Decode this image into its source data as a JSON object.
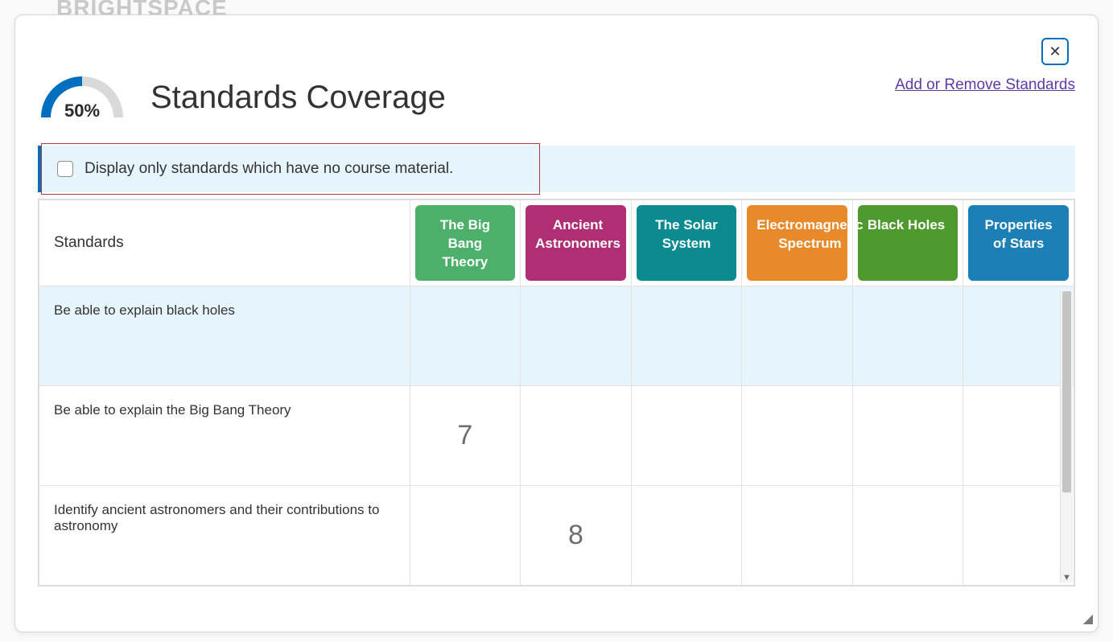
{
  "background_text": "BRIGHTSPACE",
  "header": {
    "coverage_percent": "50%",
    "title": "Standards Coverage",
    "action_link": "Add or Remove Standards"
  },
  "filter": {
    "label": "Display only standards which have no course material."
  },
  "table": {
    "standards_header": "Standards",
    "topics": [
      {
        "label": "The Big Bang Theory",
        "color": "#4caf6a"
      },
      {
        "label": "Ancient Astronomers",
        "color": "#b02f74"
      },
      {
        "label": "The Solar System",
        "color": "#0b8a8f"
      },
      {
        "label": "Electromagnetic Spectrum",
        "color": "#e88a2a"
      },
      {
        "label": "Black Holes",
        "color": "#4f9a2f"
      },
      {
        "label": "Properties of Stars",
        "color": "#1c7fb5"
      }
    ],
    "rows": [
      {
        "standard": "Be able to explain black holes",
        "values": [
          "",
          "",
          "",
          "",
          "",
          ""
        ],
        "highlight": true
      },
      {
        "standard": "Be able to explain the Big Bang Theory",
        "values": [
          "7",
          "",
          "",
          "",
          "",
          ""
        ],
        "highlight": false
      },
      {
        "standard": "Identify ancient astronomers and their contributions to astronomy",
        "values": [
          "",
          "8",
          "",
          "",
          "",
          ""
        ],
        "highlight": false
      }
    ]
  }
}
